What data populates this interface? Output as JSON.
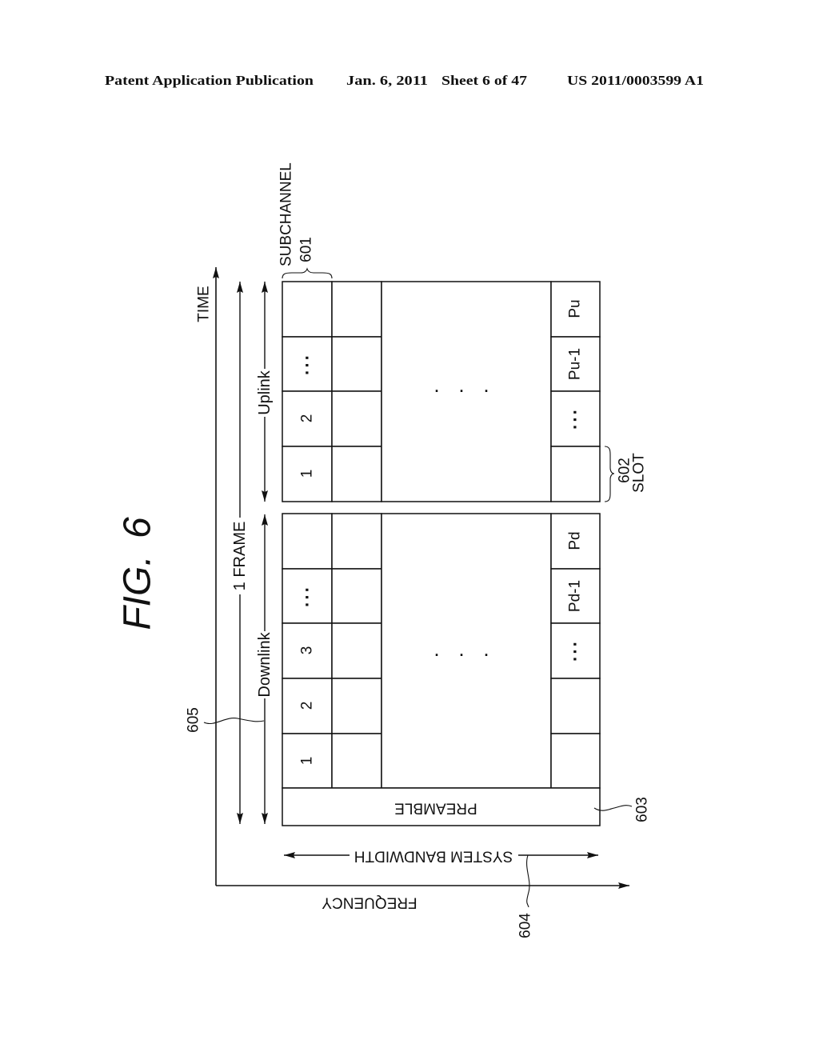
{
  "header": {
    "publication_type": "Patent Application Publication",
    "date": "Jan. 6, 2011",
    "sheet": "Sheet 6 of 47",
    "publication_number": "US 2011/0003599 A1"
  },
  "figure": {
    "title": "FIG. 6",
    "time_axis_label": "TIME",
    "frequency_axis_label": "FREQUENCY",
    "frame_label": "1 FRAME",
    "time_arrows_ref": "605",
    "subchannel": {
      "label": "SUBCHANNEL",
      "ref": "601"
    },
    "slot": {
      "label": "SLOT",
      "ref": "602"
    },
    "preamble": {
      "label": "PREAMBLE",
      "ref": "603"
    },
    "system_bandwidth": {
      "label": "SYSTEM BANDWIDTH",
      "ref": "604"
    },
    "uplink": {
      "label": "Uplink",
      "first_subchannel_slots": [
        "",
        "···",
        "2",
        "1"
      ],
      "last_subchannel_slots": [
        "Pu",
        "Pu-1",
        "···",
        ""
      ],
      "middle_ellipsis": "···"
    },
    "downlink": {
      "label": "Downlink",
      "first_subchannel_slots": [
        "",
        "···",
        "3",
        "2",
        "1"
      ],
      "last_subchannel_slots": [
        "Pd",
        "Pd-1",
        "···",
        "",
        ""
      ],
      "middle_ellipsis": "···"
    }
  }
}
